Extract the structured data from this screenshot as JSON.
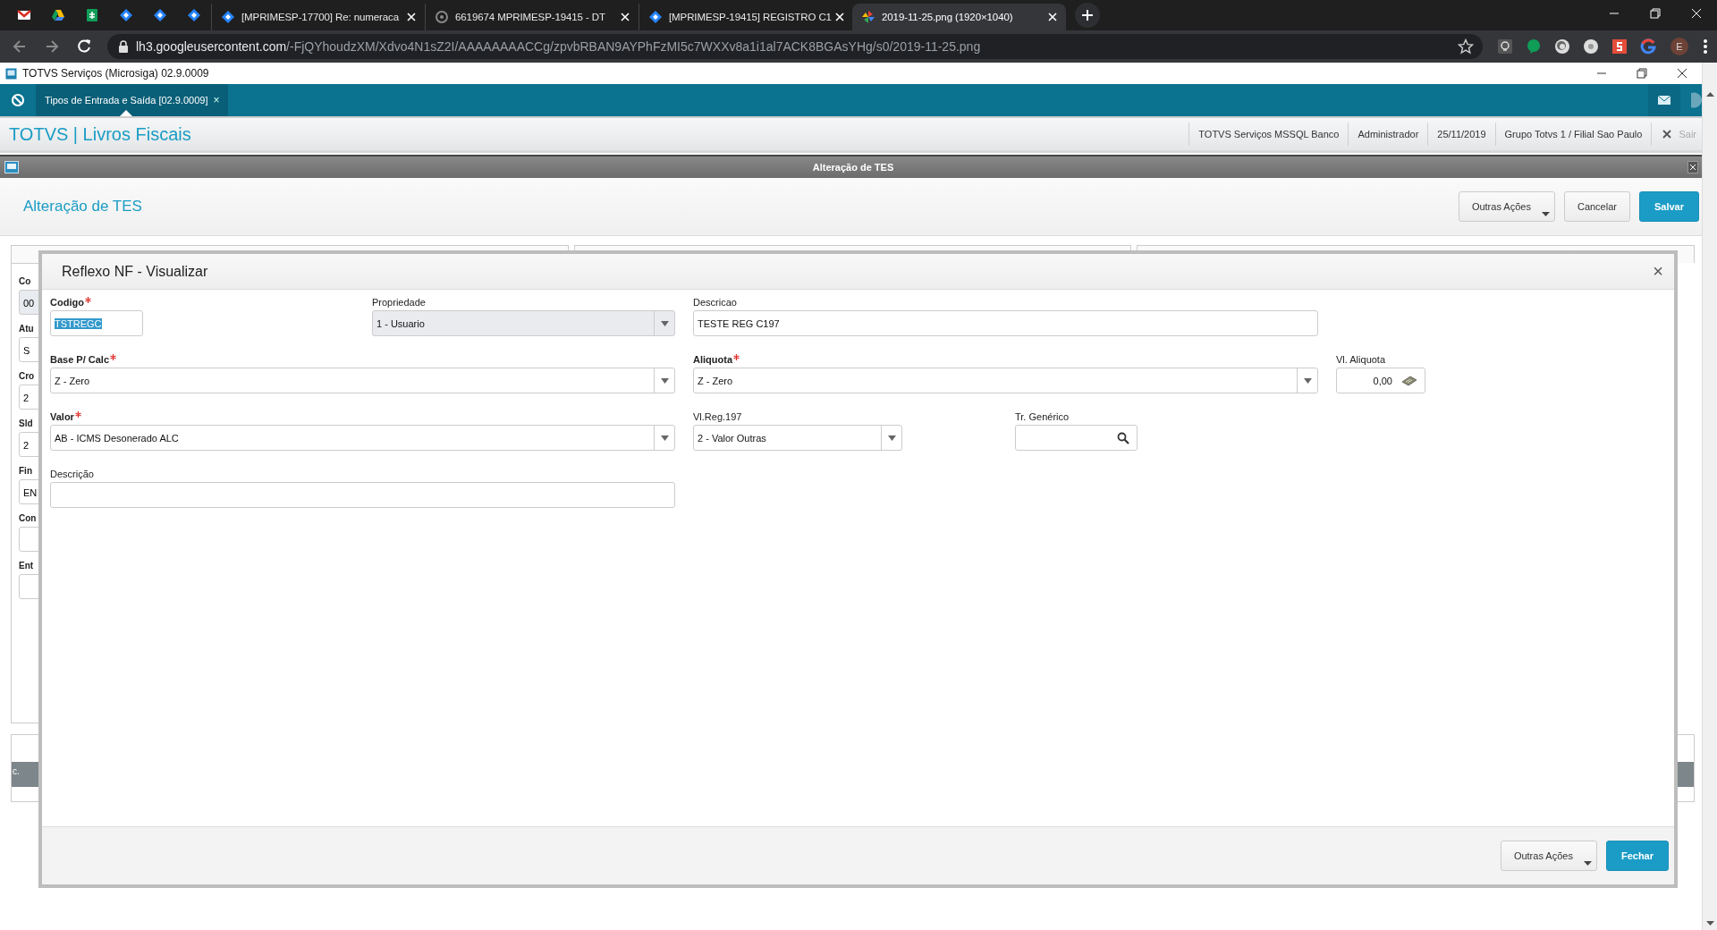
{
  "browser": {
    "pinned_tabs": [
      {
        "kind": "mail"
      },
      {
        "kind": "drive"
      },
      {
        "kind": "sheets"
      },
      {
        "kind": "diamond"
      },
      {
        "kind": "diamond"
      },
      {
        "kind": "diamond"
      }
    ],
    "tabs": [
      {
        "title": "[MPRIMESP-17700] Re: numeraca",
        "selected": false
      },
      {
        "title": "6619674 MPRIMESP-19415 - DT",
        "selected": false
      },
      {
        "title": "[MPRIMESP-19415] REGISTRO C1",
        "selected": false
      },
      {
        "title": "2019-11-25.png (1920×1040)",
        "selected": true
      }
    ],
    "address": {
      "host": "lh3.googleusercontent.com",
      "path": "/-FjQYhoudzXM/Xdvo4N1sZ2I/AAAAAAAACCg/zpvbRBAN9AYPhFzMI5c7WXXv8a1i1al7ACK8BGAsYHg/s0/2019-11-25.png"
    },
    "avatar": "E"
  },
  "window": {
    "title": "TOTVS Serviços (Microsiga) 02.9.0009"
  },
  "app_tab": {
    "label": "Tipos de Entrada e Saída [02.9.0009]",
    "close": "×"
  },
  "header": {
    "brand": "TOTVS | Livros Fiscais",
    "info": [
      "TOTVS Serviços MSSQL Banco",
      "Administrador",
      "25/11/2019",
      "Grupo Totvs 1 / Filial Sao Paulo"
    ],
    "logout": "Sair"
  },
  "panel_bar": {
    "title": "Alteração de TES"
  },
  "page": {
    "title": "Alteração de TES",
    "buttons": [
      {
        "label": "Outras Ações",
        "kind": "menu"
      },
      {
        "label": "Cancelar",
        "kind": "default"
      },
      {
        "label": "Salvar",
        "kind": "primary"
      }
    ],
    "background_fields": [
      {
        "label": "Co",
        "value": "00",
        "kind": "readonly"
      },
      {
        "label": "Atu",
        "value": "S",
        "kind": "input"
      },
      {
        "label": "Cro",
        "value": "2",
        "kind": "input"
      },
      {
        "label": "Sld",
        "value": "2",
        "kind": "input"
      },
      {
        "label": "Fin",
        "value": "EN",
        "kind": "input"
      },
      {
        "label": "Con",
        "kind": "input"
      },
      {
        "label": "Ent",
        "kind": "input"
      }
    ],
    "grid_header": "c."
  },
  "modal": {
    "title": "Reflexo NF - Visualizar",
    "close": "×",
    "fields": [
      {
        "label": "Codigo",
        "required": true,
        "kind": "text",
        "value": "TSTREGC",
        "highlighted": true
      },
      {
        "label": "Propriedade",
        "required": false,
        "kind": "select",
        "value": "1 - Usuario",
        "disabled": true
      },
      {
        "label": "Descricao",
        "required": false,
        "kind": "text",
        "value": "TESTE REG C197"
      },
      {
        "label": "Base P/ Calc",
        "required": true,
        "kind": "select",
        "value": "Z - Zero"
      },
      {
        "label": "Aliquota",
        "required": true,
        "kind": "select",
        "value": "Z - Zero"
      },
      {
        "label": "Vl. Aliquota",
        "required": false,
        "kind": "number",
        "value": "0,00"
      },
      {
        "label": "Valor",
        "required": true,
        "kind": "select",
        "value": "AB - ICMS Desonerado ALC"
      },
      {
        "label": "Vl.Reg.197",
        "required": false,
        "kind": "select",
        "value": "2 - Valor Outras"
      },
      {
        "label": "Tr. Genérico",
        "required": false,
        "kind": "search"
      },
      {
        "label": "Descrição",
        "required": false,
        "kind": "text"
      }
    ],
    "buttons": [
      {
        "label": "Outras Ações",
        "kind": "menu"
      },
      {
        "label": "Fechar",
        "kind": "primary"
      }
    ]
  }
}
